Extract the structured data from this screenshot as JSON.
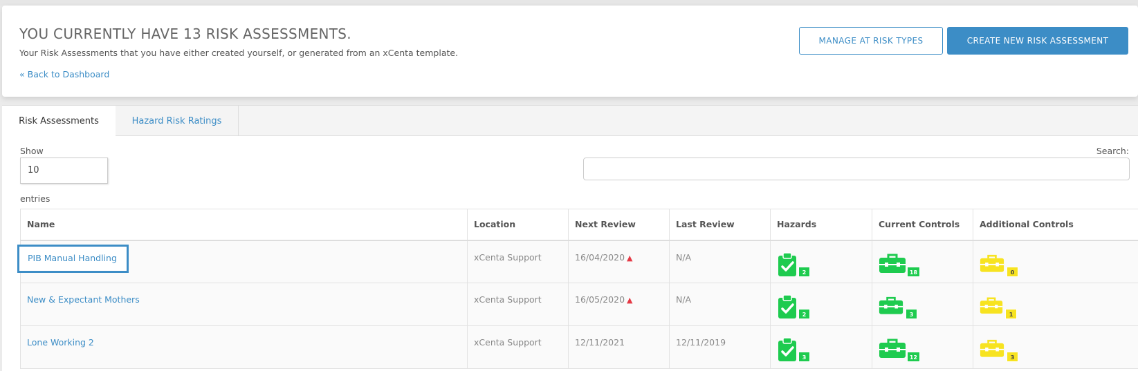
{
  "header": {
    "title": "YOU CURRENTLY HAVE 13 RISK ASSESSMENTS.",
    "subtitle": "Your Risk Assessments that you have either created yourself, or generated from an xCenta template.",
    "back_link": "« Back to Dashboard",
    "manage_button": "MANAGE AT RISK TYPES",
    "create_button": "CREATE NEW RISK ASSESSMENT"
  },
  "tabs": [
    {
      "label": "Risk Assessments",
      "active": true
    },
    {
      "label": "Hazard Risk Ratings",
      "active": false
    }
  ],
  "controls": {
    "show_label": "Show",
    "page_length": "10",
    "entries_label": "entries",
    "search_label": "Search:",
    "search_value": ""
  },
  "table": {
    "columns": [
      "Name",
      "Location",
      "Next Review",
      "Last Review",
      "Hazards",
      "Current Controls",
      "Additional Controls"
    ],
    "rows": [
      {
        "name": "PIB Manual Handling",
        "location": "xCenta Support",
        "next_review": "16/04/2020",
        "next_overdue": true,
        "last_review": "N/A",
        "hazards": "2",
        "current_controls": "18",
        "additional_controls": "0"
      },
      {
        "name": "New & Expectant Mothers",
        "location": "xCenta Support",
        "next_review": "16/05/2020",
        "next_overdue": true,
        "last_review": "N/A",
        "hazards": "2",
        "current_controls": "3",
        "additional_controls": "1"
      },
      {
        "name": "Lone Working 2",
        "location": "xCenta Support",
        "next_review": "12/11/2021",
        "next_overdue": false,
        "last_review": "12/11/2019",
        "hazards": "3",
        "current_controls": "12",
        "additional_controls": "3"
      }
    ]
  },
  "colors": {
    "accent": "#3c8dc6",
    "green": "#1ecb4f",
    "yellow": "#f7e320",
    "warning": "#e53945"
  },
  "icons": {
    "hazards": "clipboard-check-icon",
    "current_controls": "toolbox-icon",
    "additional_controls": "toolbox-icon",
    "overdue": "warning-triangle-icon"
  }
}
